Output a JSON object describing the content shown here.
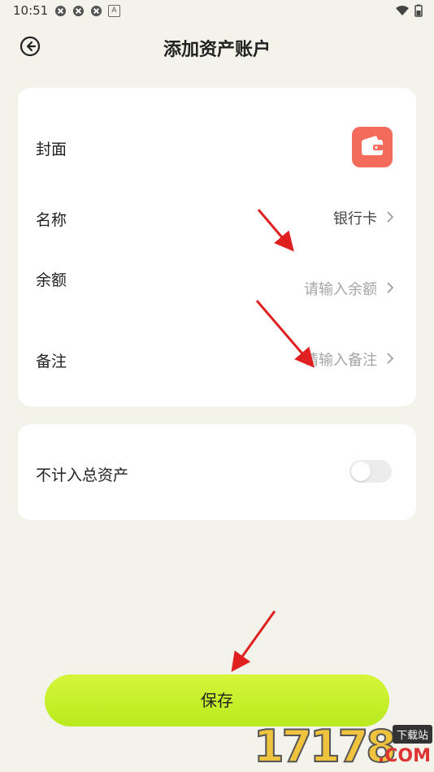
{
  "status": {
    "time": "10:51",
    "badge": "A"
  },
  "header": {
    "title": "添加资产账户"
  },
  "form": {
    "cover_label": "封面",
    "name_label": "名称",
    "name_value": "银行卡",
    "balance_label": "余额",
    "balance_placeholder": "请输入余额",
    "note_label": "备注",
    "note_placeholder": "请输入备注"
  },
  "settings": {
    "exclude_label": "不计入总资产",
    "exclude_enabled": false
  },
  "actions": {
    "save_label": "保存"
  },
  "watermark": {
    "digits": "17178",
    "tag": "下载站",
    "suffix": ".COM"
  },
  "colors": {
    "cover": "#f36b5b",
    "save_button": "#c8f02a",
    "annotation_arrow": "#e02020"
  }
}
